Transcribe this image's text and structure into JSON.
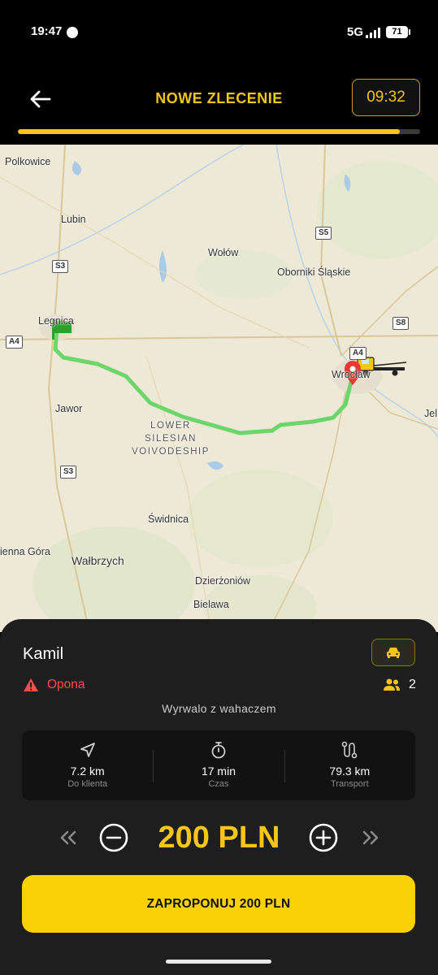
{
  "status_bar": {
    "time": "19:47",
    "network": "5G",
    "battery": "71"
  },
  "header": {
    "title": "NOWE ZLECENIE",
    "timer": "09:32",
    "progress_fraction": 0.95
  },
  "map": {
    "places": {
      "polkowice": "Polkowice",
      "lubin": "Lubin",
      "wolow": "Wołów",
      "oborniki": "Oborniki Śląskie",
      "legnica": "Legnica",
      "wroclaw": "Wrocław",
      "jawor": "Jawor",
      "region_line1": "LOWER",
      "region_line2": "SILESIAN",
      "region_line3": "VOIVODESHIP",
      "swidnica": "Świdnica",
      "kamienna": "ienna Góra",
      "walbrzych": "Wałbrzych",
      "dzierzoniow": "Dzierżoniów",
      "bielawa": "Bielawa",
      "jel": "Jel"
    },
    "roads": {
      "s5": "S5",
      "s3_north": "S3",
      "s8": "S8",
      "a4_west": "A4",
      "a4_east": "A4",
      "s3_south": "S3"
    },
    "route_color": "#6cd66c",
    "origin_marker_color": "#2ea02e",
    "destination_pin_color": "#e53935"
  },
  "order": {
    "client_name": "Kamil",
    "issue": "Opona",
    "passengers": "2",
    "description": "Wyrwalo z wahaczem",
    "stats": [
      {
        "icon": "navigation-arrow-icon",
        "value": "7.2 km",
        "label": "Do klienta"
      },
      {
        "icon": "stopwatch-icon",
        "value": "17 min",
        "label": "Czas"
      },
      {
        "icon": "route-icon",
        "value": "79.3 km",
        "label": "Transport"
      }
    ],
    "price": "200 PLN",
    "propose_label": "ZAPROPONUJ 200 PLN"
  },
  "colors": {
    "accent": "#f5c518",
    "danger": "#ff4d4d",
    "sheet": "#1e1e1e",
    "button": "#f9d105"
  }
}
